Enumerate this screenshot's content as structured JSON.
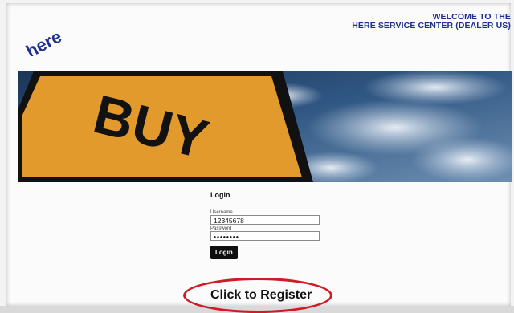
{
  "header": {
    "logo_text": "here",
    "welcome_line1": "WELCOME TO THE",
    "welcome_line2": "HERE SERVICE CENTER (DEALER US)"
  },
  "banner": {
    "sign_text": "BUY"
  },
  "login": {
    "title": "Login",
    "username_label": "Username",
    "username_value": "12345678",
    "password_label": "Password",
    "password_value": "••••••••",
    "submit_label": "Login"
  },
  "register": {
    "label": "Click to Register"
  },
  "colors": {
    "brand_blue": "#1d2f8f",
    "sign_orange": "#e39a2c",
    "highlight_red": "#d11b24"
  }
}
